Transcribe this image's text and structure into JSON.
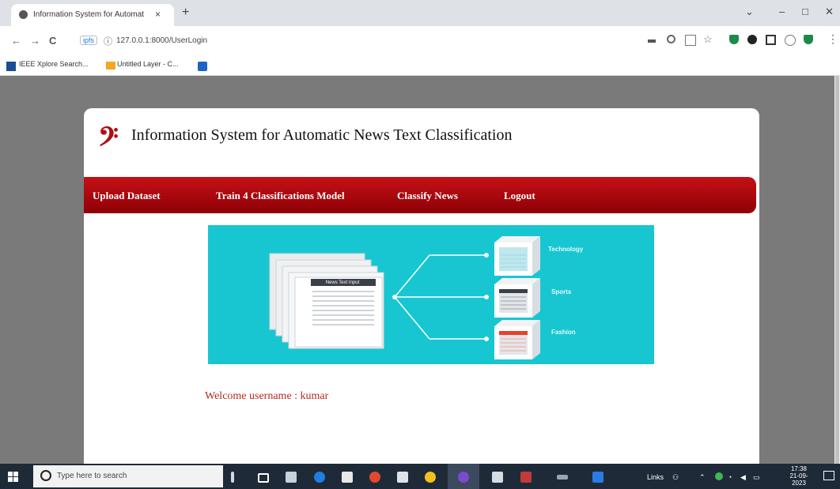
{
  "browser": {
    "tab_title": "Information System for Automat",
    "tab_close": "×",
    "new_tab": "+",
    "window_controls": {
      "dropdown": "⌄",
      "minimize": "–",
      "maximize": "□",
      "close": "✕"
    },
    "nav": {
      "back": "←",
      "forward": "→",
      "reload": "C"
    },
    "address": {
      "badge": "ipfs",
      "url": "127.0.0.1:8000/UserLogin"
    },
    "bookmarks": [
      {
        "label": "IEEE Xplore Search..."
      },
      {
        "label": "Untitled Layer - C..."
      }
    ]
  },
  "page": {
    "logo_glyph": "𝄢",
    "title": "Information System for Automatic News Text Classification",
    "nav_items": [
      {
        "label": "Upload Dataset"
      },
      {
        "label": "Train 4 Classifications Model"
      },
      {
        "label": "Classify News"
      },
      {
        "label": "Logout"
      }
    ],
    "banner": {
      "doc_header": "News Text Input",
      "categories": [
        {
          "label": "Technology",
          "color": "#bfe7ee"
        },
        {
          "label": "Sports",
          "color": "#3b3f48"
        },
        {
          "label": "Fashion",
          "color": "#e8412c"
        }
      ]
    },
    "welcome": "Welcome username : kumar"
  },
  "taskbar": {
    "search_placeholder": "Type here to search",
    "tray_time": "17:38",
    "tray_date": "21-09-2023",
    "tray_lang": "Links"
  },
  "colors": {
    "brand": "#b10d13",
    "banner_bg": "#18c6d1",
    "page_bg": "#7a7a7a"
  }
}
